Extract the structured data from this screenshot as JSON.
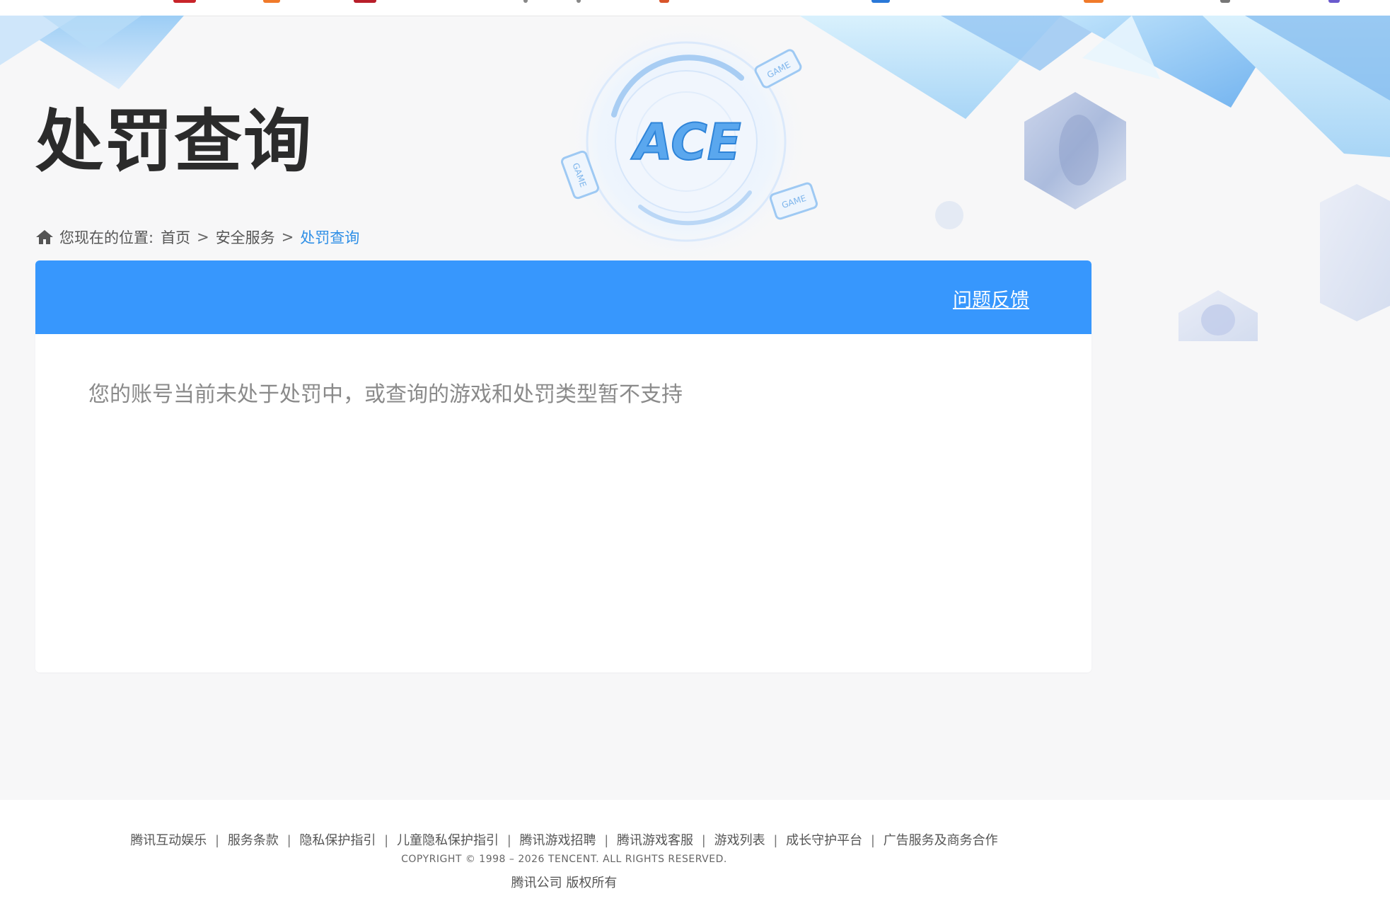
{
  "page": {
    "title": "处罚查询"
  },
  "hero": {
    "logo_text": "ACE",
    "badge_text": "GAME"
  },
  "breadcrumb": {
    "prefix": "您现在的位置:",
    "items": [
      {
        "label": "首页"
      },
      {
        "label": "安全服务"
      },
      {
        "label": "处罚查询"
      }
    ],
    "separator": ">"
  },
  "panel": {
    "feedback_label": "问题反馈",
    "message": "您的账号当前未处于处罚中，或查询的游戏和处罚类型暂不支持"
  },
  "footer": {
    "links": [
      {
        "label": "腾讯互动娱乐"
      },
      {
        "label": "服务条款"
      },
      {
        "label": "隐私保护指引"
      },
      {
        "label": "儿童隐私保护指引"
      },
      {
        "label": "腾讯游戏招聘"
      },
      {
        "label": "腾讯游戏客服"
      },
      {
        "label": "游戏列表"
      },
      {
        "label": "成长守护平台"
      },
      {
        "label": "广告服务及商务合作"
      }
    ],
    "separator": "|",
    "copyright": "COPYRIGHT © 1998 – 2026 TENCENT. ALL RIGHTS RESERVED.",
    "company": "腾讯公司 版权所有"
  },
  "colors": {
    "accent_blue": "#3797fd",
    "breadcrumb_current": "#2f8fe6",
    "page_bg": "#f7f7f8"
  }
}
